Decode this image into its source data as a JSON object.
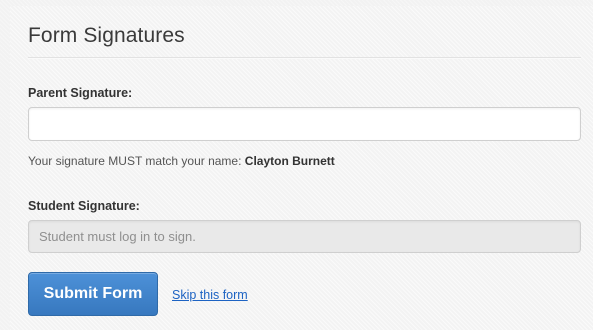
{
  "form": {
    "title": "Form Signatures",
    "parent_signature": {
      "label": "Parent Signature:",
      "value": "",
      "placeholder": ""
    },
    "hint": {
      "prefix": "Your signature MUST match your name: ",
      "name": "Clayton Burnett"
    },
    "student_signature": {
      "label": "Student Signature:",
      "value": "",
      "placeholder": "Student must log in to sign."
    },
    "submit_label": "Submit Form",
    "skip_label": "Skip this form"
  },
  "colors": {
    "primary_button": "#4d91d8",
    "link": "#1d63c3",
    "background": "#f2f2f2"
  }
}
